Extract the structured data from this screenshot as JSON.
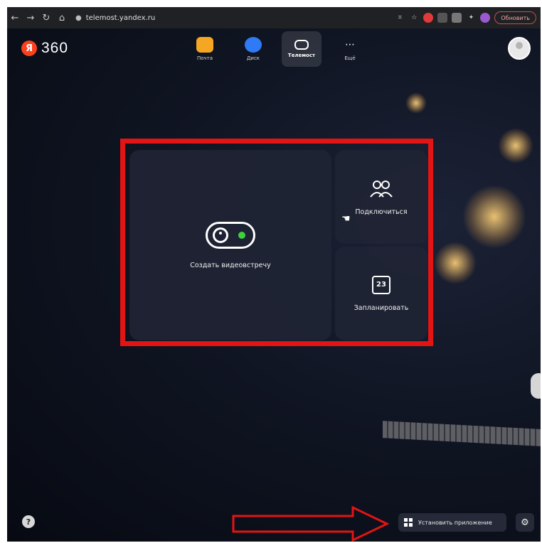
{
  "browser": {
    "url": "telemost.yandex.ru",
    "update_label": "Обновить"
  },
  "app": {
    "logo_badge": "Я",
    "logo_text": "360"
  },
  "services": [
    {
      "label": "Почта",
      "icon": "mail-icon",
      "color": "#f5a623"
    },
    {
      "label": "Диск",
      "icon": "disk-icon",
      "color": "#2f7bf5"
    },
    {
      "label": "Телемост",
      "icon": "telemost-icon",
      "color": "#2a2e3c",
      "active": true
    },
    {
      "label": "Ещё",
      "icon": "more-icon",
      "color": "transparent"
    }
  ],
  "cards": {
    "create_label": "Создать видеовстречу",
    "join_label": "Подключиться",
    "schedule_label": "Запланировать",
    "calendar_day": "23"
  },
  "footer": {
    "install_label": "Установить приложение",
    "help_glyph": "?"
  },
  "colors": {
    "annotation_red": "#e21414",
    "accent_green": "#3ed13e",
    "brand_red": "#fc3f1d"
  }
}
